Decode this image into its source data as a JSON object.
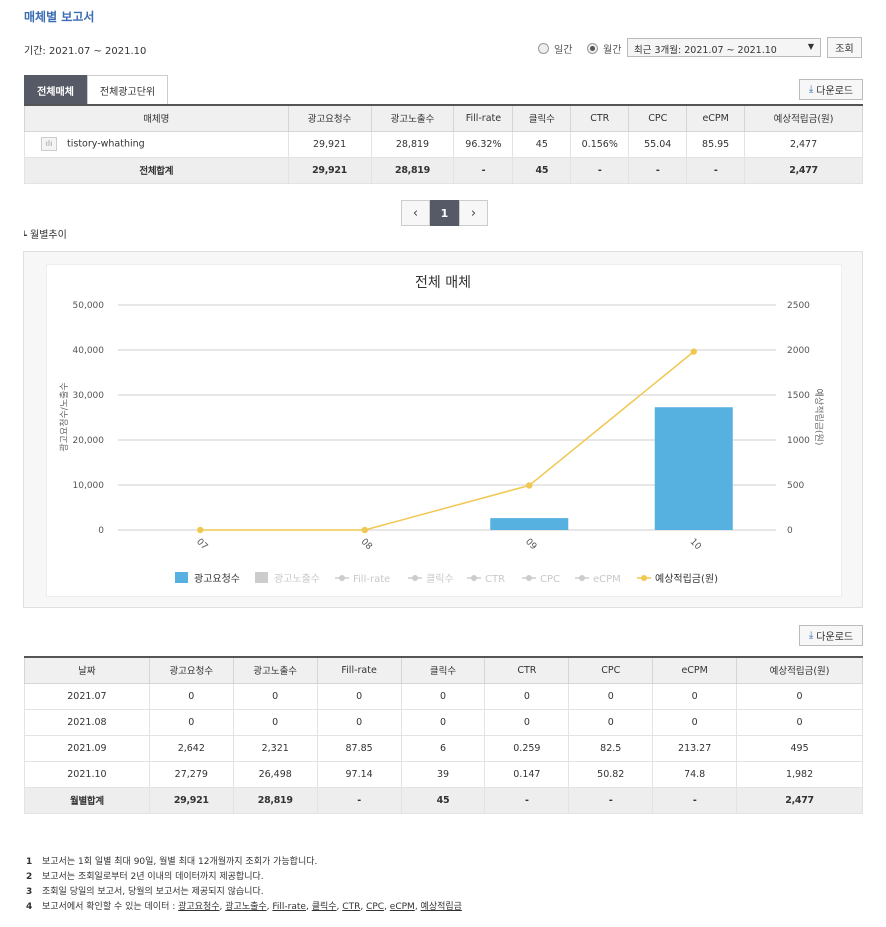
{
  "page": {
    "title": "매체별 보고서",
    "period_label": "기간: 2021.07 ~ 2021.10"
  },
  "filters": {
    "daily_label": "일간",
    "monthly_label": "월간",
    "selected": "monthly",
    "range_select": "최근 3개월: 2021.07 ~ 2021.10",
    "search_button": "조회"
  },
  "tabs": [
    {
      "label": "전체매체",
      "active": true
    },
    {
      "label": "전체광고단위",
      "active": false
    }
  ],
  "download_label": "다운로드",
  "summary_table": {
    "headers": [
      "매체명",
      "광고요청수",
      "광고노출수",
      "Fill-rate",
      "클릭수",
      "CTR",
      "CPC",
      "eCPM",
      "예상적립금(원)"
    ],
    "rows": [
      [
        "tistory-whathing",
        "29,921",
        "28,819",
        "96.32%",
        "45",
        "0.156%",
        "55.04",
        "85.95",
        "2,477"
      ]
    ],
    "total": [
      "전체합계",
      "29,921",
      "28,819",
      "-",
      "45",
      "-",
      "-",
      "-",
      "2,477"
    ]
  },
  "pager": {
    "prev": "‹",
    "current": "1",
    "next": "›"
  },
  "section_label": "월별추이",
  "chart_data": {
    "type": "bar",
    "title": "전체 매체",
    "categories": [
      "07",
      "08",
      "09",
      "10"
    ],
    "ylabel": "광고요청수/노출수",
    "y2label": "예상적립금(원)",
    "ylim": [
      0,
      50000
    ],
    "y2lim": [
      0,
      2500
    ],
    "yticks": [
      "50,000",
      "40,000",
      "30,000",
      "20,000",
      "10,000",
      "0"
    ],
    "y2ticks": [
      "2500",
      "2000",
      "1500",
      "1000",
      "500",
      "0"
    ],
    "grid": true,
    "legend_position": "bottom",
    "series": [
      {
        "name": "광고요청수",
        "kind": "bar",
        "values": [
          0,
          0,
          2642,
          27279
        ],
        "color": "#56b0e0",
        "active": true
      },
      {
        "name": "광고노출수",
        "kind": "bar",
        "values": [
          0,
          0,
          2321,
          26498
        ],
        "color": "#cccccc",
        "active": false
      },
      {
        "name": "Fill-rate",
        "kind": "line",
        "values": [
          0,
          0,
          87.85,
          97.14
        ],
        "color": "#cccccc",
        "active": false
      },
      {
        "name": "클릭수",
        "kind": "line",
        "values": [
          0,
          0,
          6,
          39
        ],
        "color": "#cccccc",
        "active": false
      },
      {
        "name": "CTR",
        "kind": "line",
        "values": [
          0,
          0,
          0.259,
          0.147
        ],
        "color": "#cccccc",
        "active": false
      },
      {
        "name": "CPC",
        "kind": "line",
        "values": [
          0,
          0,
          82.5,
          50.82
        ],
        "color": "#cccccc",
        "active": false
      },
      {
        "name": "eCPM",
        "kind": "line",
        "values": [
          0,
          0,
          213.27,
          74.8
        ],
        "color": "#cccccc",
        "active": false
      },
      {
        "name": "예상적립금(원)",
        "kind": "line",
        "axis": "y2",
        "values": [
          0,
          0,
          495,
          1982
        ],
        "color": "#f0c850",
        "active": true
      }
    ]
  },
  "monthly_table": {
    "headers": [
      "날짜",
      "광고요청수",
      "광고노출수",
      "Fill-rate",
      "클릭수",
      "CTR",
      "CPC",
      "eCPM",
      "예상적립금(원)"
    ],
    "rows": [
      [
        "2021.07",
        "0",
        "0",
        "0",
        "0",
        "0",
        "0",
        "0",
        "0"
      ],
      [
        "2021.08",
        "0",
        "0",
        "0",
        "0",
        "0",
        "0",
        "0",
        "0"
      ],
      [
        "2021.09",
        "2,642",
        "2,321",
        "87.85",
        "6",
        "0.259",
        "82.5",
        "213.27",
        "495"
      ],
      [
        "2021.10",
        "27,279",
        "26,498",
        "97.14",
        "39",
        "0.147",
        "50.82",
        "74.8",
        "1,982"
      ]
    ],
    "total": [
      "월별합계",
      "29,921",
      "28,819",
      "-",
      "45",
      "-",
      "-",
      "-",
      "2,477"
    ]
  },
  "notes": [
    {
      "num": "1",
      "text": "보고서는 1회 일별 최대 90일, 월별 최대 12개월까지 조회가 가능합니다."
    },
    {
      "num": "2",
      "text": "보고서는 조회일로부터 2년 이내의 데이터까지 제공합니다."
    },
    {
      "num": "3",
      "text": "조회일 당일의 보고서, 당월의 보고서는 제공되지 않습니다."
    },
    {
      "num": "4",
      "text": "보고서에서 확인할 수 있는 데이터 : ",
      "links": [
        "광고요청수",
        "광고노출수",
        "Fill-rate",
        "클릭수",
        "CTR",
        "CPC",
        "eCPM",
        "예상적립금"
      ]
    }
  ]
}
